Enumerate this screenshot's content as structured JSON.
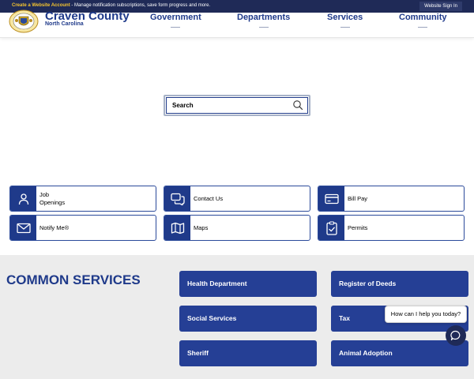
{
  "topbar": {
    "account_link": "Create a Website Account",
    "account_message": " - Manage notification subscriptions, save form progress and more.",
    "sign_in": "Website Sign In"
  },
  "header": {
    "logo_title": "Craven County",
    "logo_subtitle": "North Carolina",
    "nav": [
      "Government",
      "Departments",
      "Services",
      "Community"
    ]
  },
  "search": {
    "placeholder": "Search"
  },
  "quick_links": [
    {
      "label": "Job Openings",
      "icon": "person-icon"
    },
    {
      "label": "Contact Us",
      "icon": "chat-bubbles-icon"
    },
    {
      "label": "Bill Pay",
      "icon": "credit-card-icon"
    },
    {
      "label": "Notify Me®",
      "icon": "envelope-icon"
    },
    {
      "label": "Maps",
      "icon": "map-icon"
    },
    {
      "label": "Permits",
      "icon": "clipboard-icon"
    }
  ],
  "common_services": {
    "title": "COMMON SERVICES",
    "items": [
      "Health Department",
      "Register of Deeds",
      "Social Services",
      "Tax",
      "Sheriff",
      "Animal Adoption"
    ]
  },
  "chat": {
    "prompt": "How can I help you today?"
  },
  "colors": {
    "brand_blue": "#1f3a8a",
    "topbar_navy": "#1f2a57",
    "account_link_yellow": "#f4c430",
    "band_gray": "#ececec"
  }
}
